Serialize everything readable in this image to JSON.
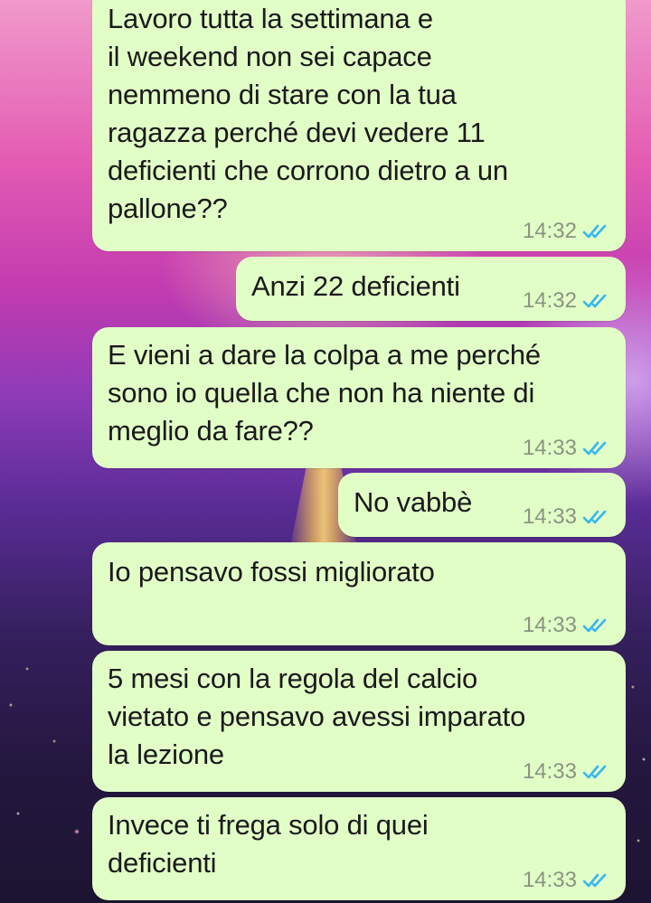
{
  "chat": {
    "messages": [
      {
        "text": "Lavoro tutta la settimana e\nil weekend non sei capace\nnemmeno di stare con la tua\nragazza perché devi vedere 11\ndeficienti che corrono dietro a un\npallone??",
        "time": "14:32",
        "status_icon": "double-check-read-icon"
      },
      {
        "text": "Anzi 22 deficienti",
        "time": "14:32",
        "status_icon": "double-check-read-icon"
      },
      {
        "text": "E vieni a dare la colpa a me perché\nsono io quella che non ha niente di\nmeglio da fare??",
        "time": "14:33",
        "status_icon": "double-check-read-icon"
      },
      {
        "text": "No vabbè",
        "time": "14:33",
        "status_icon": "double-check-read-icon"
      },
      {
        "text": "Io pensavo fossi migliorato",
        "time": "14:33",
        "status_icon": "double-check-read-icon"
      },
      {
        "text": "5 mesi con la regola del calcio\nvietato e pensavo avessi imparato\nla lezione",
        "time": "14:33",
        "status_icon": "double-check-read-icon"
      },
      {
        "text": "Invece ti frega solo di quei\ndeficienti",
        "time": "14:33",
        "status_icon": "double-check-read-icon"
      }
    ]
  },
  "colors": {
    "bubble_outgoing": "#e2fec7",
    "read_tick": "#34b7f1",
    "timestamp": "#8a9482"
  }
}
